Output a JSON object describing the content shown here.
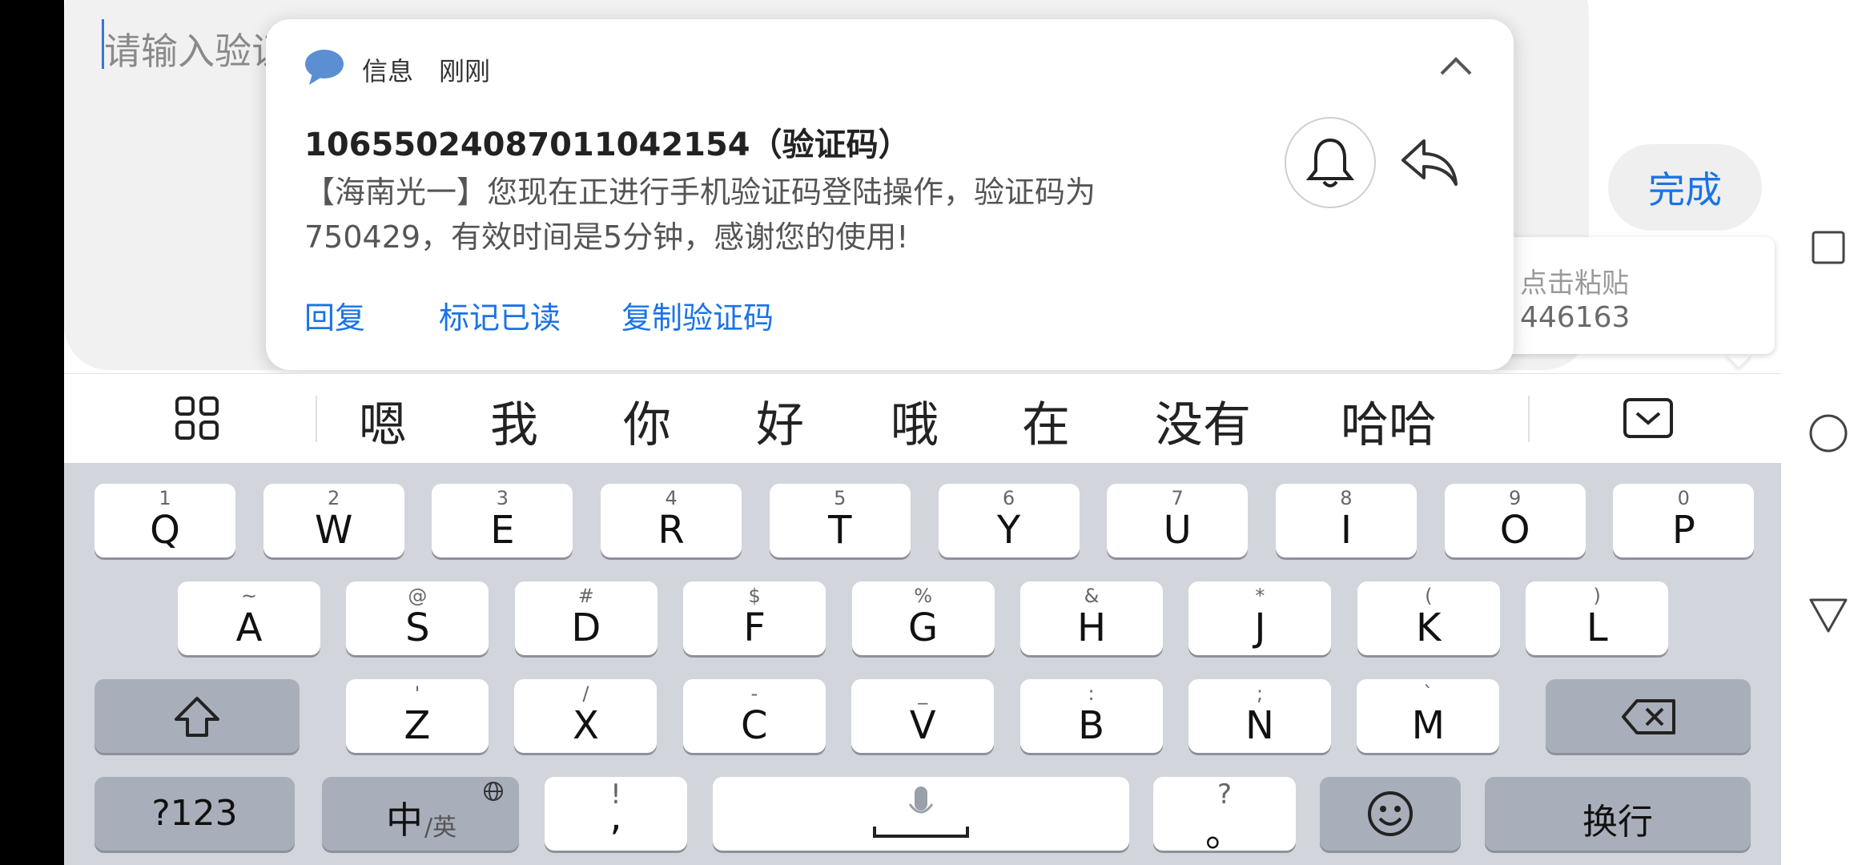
{
  "input": {
    "placeholder": "请输入验证"
  },
  "done_button": {
    "label": "完成"
  },
  "paste_popup": {
    "label": "点击粘贴",
    "code": "446163"
  },
  "notification": {
    "app": "信息",
    "time": "刚刚",
    "sender": "10655024087011042154（验证码）",
    "body": "【海南光一】您现在正进行手机验证码登陆操作，验证码为750429，有效时间是5分钟，感谢您的使用!",
    "actions": [
      "回复",
      "标记已读",
      "复制验证码"
    ]
  },
  "candidates": [
    "嗯",
    "我",
    "你",
    "好",
    "哦",
    "在",
    "没有",
    "哈哈"
  ],
  "keyboard": {
    "row1": [
      {
        "k": "Q",
        "h": "1"
      },
      {
        "k": "W",
        "h": "2"
      },
      {
        "k": "E",
        "h": "3"
      },
      {
        "k": "R",
        "h": "4"
      },
      {
        "k": "T",
        "h": "5"
      },
      {
        "k": "Y",
        "h": "6"
      },
      {
        "k": "U",
        "h": "7"
      },
      {
        "k": "I",
        "h": "8"
      },
      {
        "k": "O",
        "h": "9"
      },
      {
        "k": "P",
        "h": "0"
      }
    ],
    "row2": [
      {
        "k": "A",
        "h": "~"
      },
      {
        "k": "S",
        "h": "@"
      },
      {
        "k": "D",
        "h": "#"
      },
      {
        "k": "F",
        "h": "$"
      },
      {
        "k": "G",
        "h": "%"
      },
      {
        "k": "H",
        "h": "&"
      },
      {
        "k": "J",
        "h": "*"
      },
      {
        "k": "K",
        "h": "("
      },
      {
        "k": "L",
        "h": ")"
      }
    ],
    "row3": [
      {
        "k": "Z",
        "h": "'"
      },
      {
        "k": "X",
        "h": "/"
      },
      {
        "k": "C",
        "h": "-"
      },
      {
        "k": "V",
        "h": "_"
      },
      {
        "k": "B",
        "h": ":"
      },
      {
        "k": "N",
        "h": ";"
      },
      {
        "k": "M",
        "h": "`"
      }
    ],
    "num_key": "?123",
    "lang_key_main": "中",
    "lang_key_sub": "/英",
    "comma_key": ",",
    "comma_hint": "!",
    "period_key": "。",
    "period_hint": "?",
    "enter_key": "换行"
  },
  "colors": {
    "accent": "#1a73e8",
    "key_bg": "#ffffff",
    "key_dark": "#a9afba",
    "keyboard_bg": "#d2d5db"
  }
}
